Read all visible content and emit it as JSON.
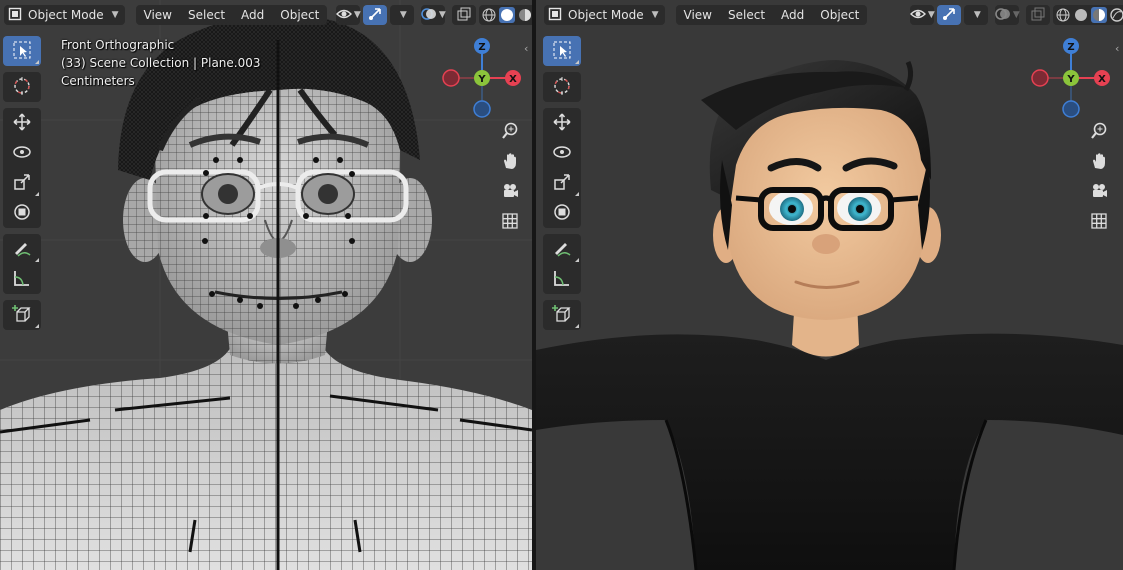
{
  "left_viewport": {
    "mode": "Object Mode",
    "menus": [
      "View",
      "Select",
      "Add",
      "Object"
    ],
    "overlay": {
      "view_name": "Front Orthographic",
      "collection": "(33) Scene Collection | Plane.003",
      "units": "Centimeters"
    },
    "shading": "solid"
  },
  "right_viewport": {
    "mode": "Object Mode",
    "menus": [
      "View",
      "Select",
      "Add",
      "Object"
    ],
    "shading": "material-preview"
  },
  "gizmo": {
    "z": "Z",
    "y": "Y",
    "x": "X"
  },
  "colors": {
    "accent": "#4772b3",
    "axis_x": "#e64152",
    "axis_y": "#8bc43b",
    "axis_z": "#3f7fd6",
    "header_button": "#2b2b2b",
    "viewport_bg": "#3c3c3c"
  },
  "icons": {
    "toolbar": [
      "select-box-icon",
      "cursor-icon",
      "move-icon",
      "rotate-icon",
      "scale-icon",
      "transform-icon",
      "annotate-icon",
      "measure-icon",
      "add-cube-icon"
    ],
    "navigation": [
      "zoom-icon",
      "pan-hand-icon",
      "camera-icon",
      "grid-icon"
    ]
  }
}
